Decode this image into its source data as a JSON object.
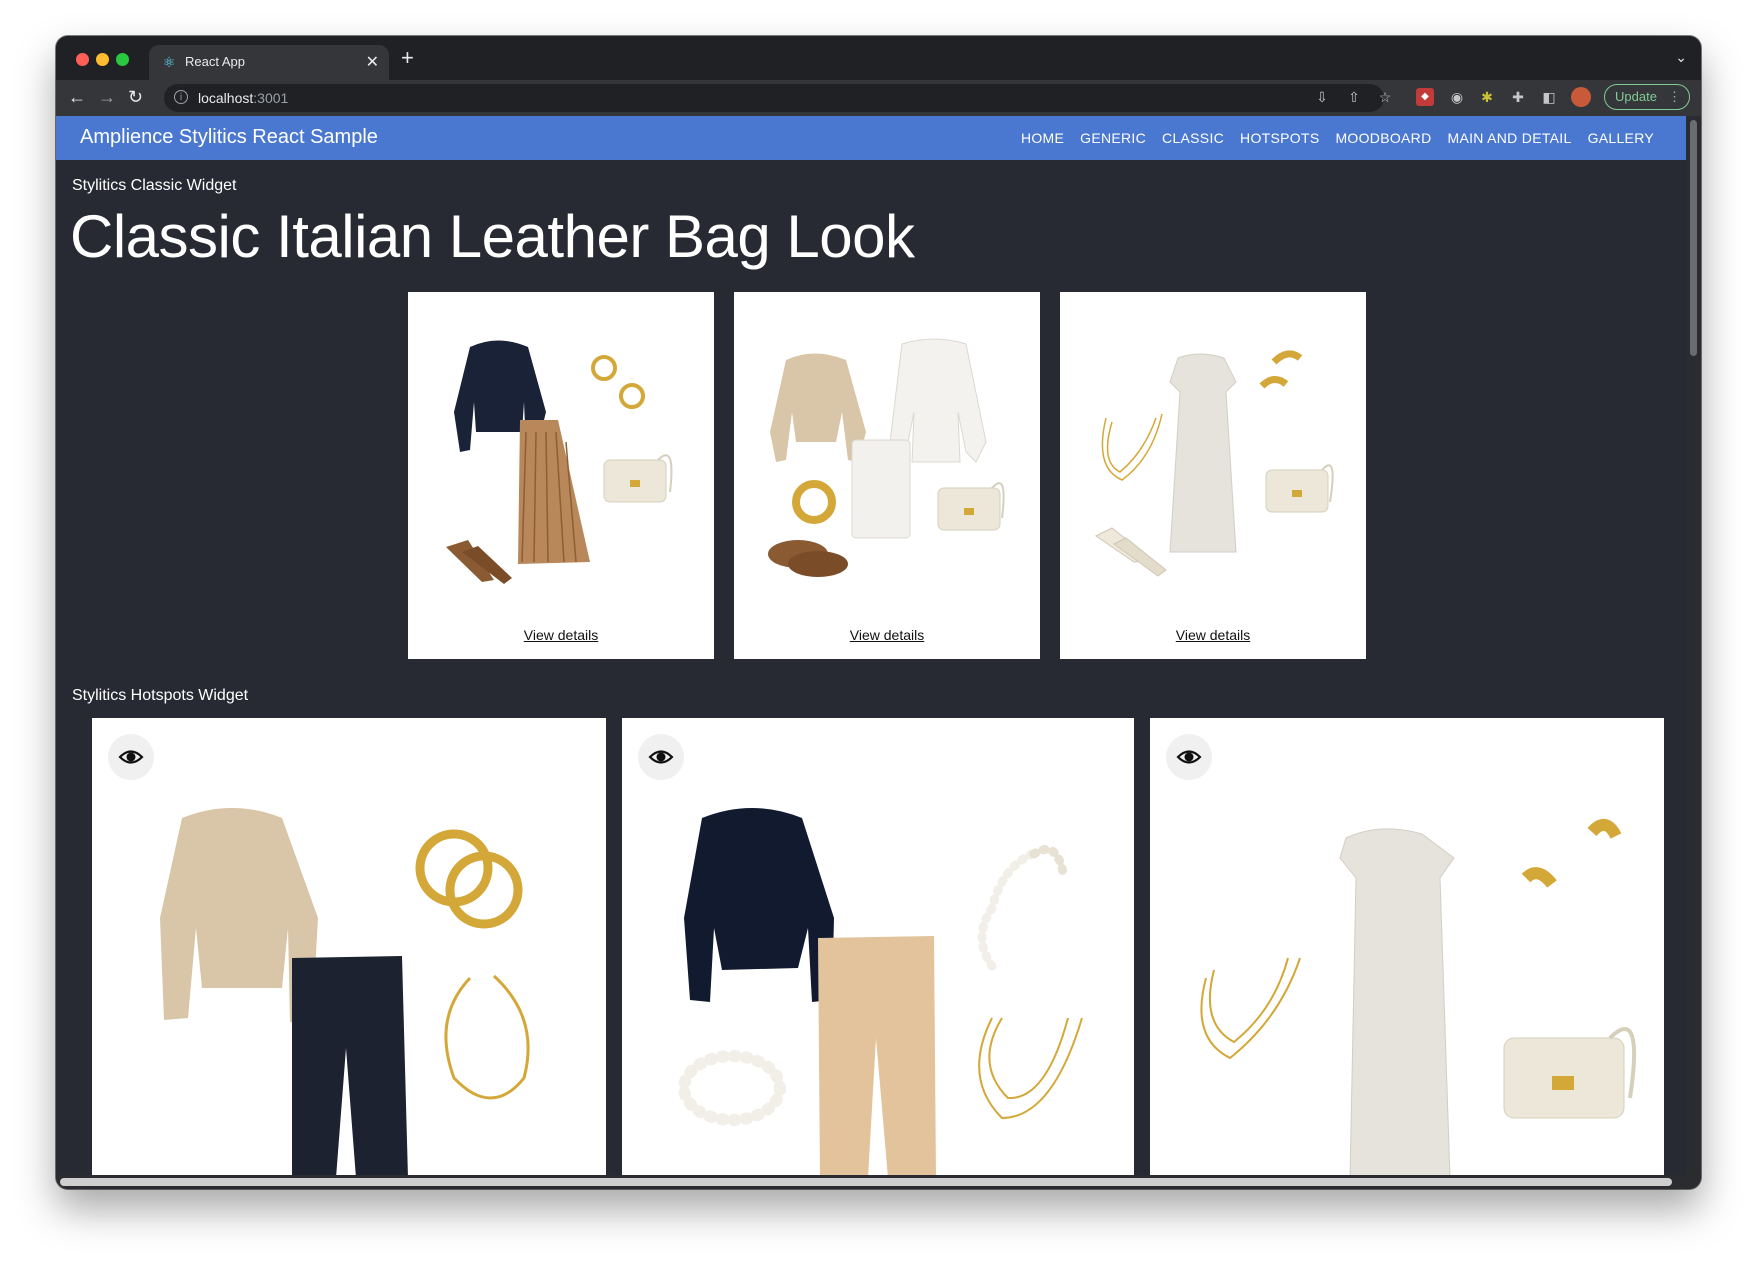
{
  "browser": {
    "tab_title": "React App",
    "url_host": "localhost",
    "url_port": ":3001",
    "update_label": "Update"
  },
  "app": {
    "brand": "Amplience Stylitics React Sample",
    "menu": [
      "HOME",
      "GENERIC",
      "CLASSIC",
      "HOTSPOTS",
      "MOODBOARD",
      "MAIN AND DETAIL",
      "GALLERY"
    ]
  },
  "classic_section": {
    "label": "Stylitics Classic Widget",
    "title": "Classic Italian Leather Bag Look",
    "cards": [
      {
        "details_label": "View details",
        "items": [
          "navy-sweater",
          "gold-earrings",
          "pleated-skirt",
          "cream-bag",
          "brown-heels"
        ]
      },
      {
        "details_label": "View details",
        "items": [
          "beige-sweater",
          "white-blazer",
          "white-skirt",
          "gold-bracelet",
          "cream-bag",
          "brown-loafers"
        ]
      },
      {
        "details_label": "View details",
        "items": [
          "ivory-dress",
          "gold-earrings",
          "gold-necklace",
          "cream-bag",
          "slingback-heels"
        ]
      }
    ]
  },
  "hotspots_section": {
    "label": "Stylitics Hotspots Widget",
    "cards": [
      {
        "items": [
          "beige-sweater",
          "gold-hoops",
          "navy-trousers",
          "gold-chain-necklace"
        ]
      },
      {
        "items": [
          "navy-sweater",
          "pearl-hoops",
          "tan-trousers",
          "pearl-bracelet",
          "layered-necklace"
        ]
      },
      {
        "items": [
          "ivory-dress",
          "gold-earrings",
          "layered-necklace",
          "cream-bag"
        ]
      }
    ]
  },
  "colors": {
    "appbar": "#4a78d0",
    "background": "#282a33",
    "navy": "#1a2238",
    "beige": "#d9c6a8",
    "gold": "#d4a838",
    "cream": "#ece7d8",
    "tan": "#e2c39c",
    "brown": "#8a5a32"
  }
}
